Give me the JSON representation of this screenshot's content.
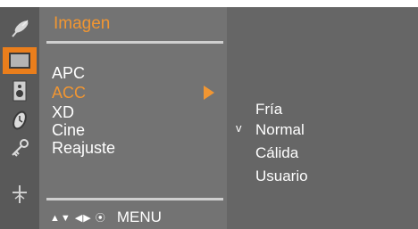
{
  "menu": {
    "title": "Imagen",
    "items": [
      {
        "label": "APC"
      },
      {
        "label": "ACC"
      },
      {
        "label": "XD"
      },
      {
        "label": "Cine"
      },
      {
        "label": "Reajuste"
      }
    ],
    "active_item": "ACC"
  },
  "submenu": {
    "options": [
      {
        "label": "Fría"
      },
      {
        "label": "Normal"
      },
      {
        "label": "Cálida"
      },
      {
        "label": "Usuario"
      }
    ],
    "selected_mark": "v",
    "selected_option": "Normal"
  },
  "footer": {
    "nav_glyphs": "▲▼ ◀▶ ⦿",
    "menu_label": "MENU"
  },
  "icons": [
    "satellite-dish-icon",
    "picture-icon",
    "speaker-icon",
    "clock-icon",
    "key-icon",
    "plus-icon"
  ],
  "colors": {
    "accent": "#f19632",
    "selected_icon_bg": "#ea7e1c",
    "panel": "#737373",
    "background": "#666666"
  }
}
